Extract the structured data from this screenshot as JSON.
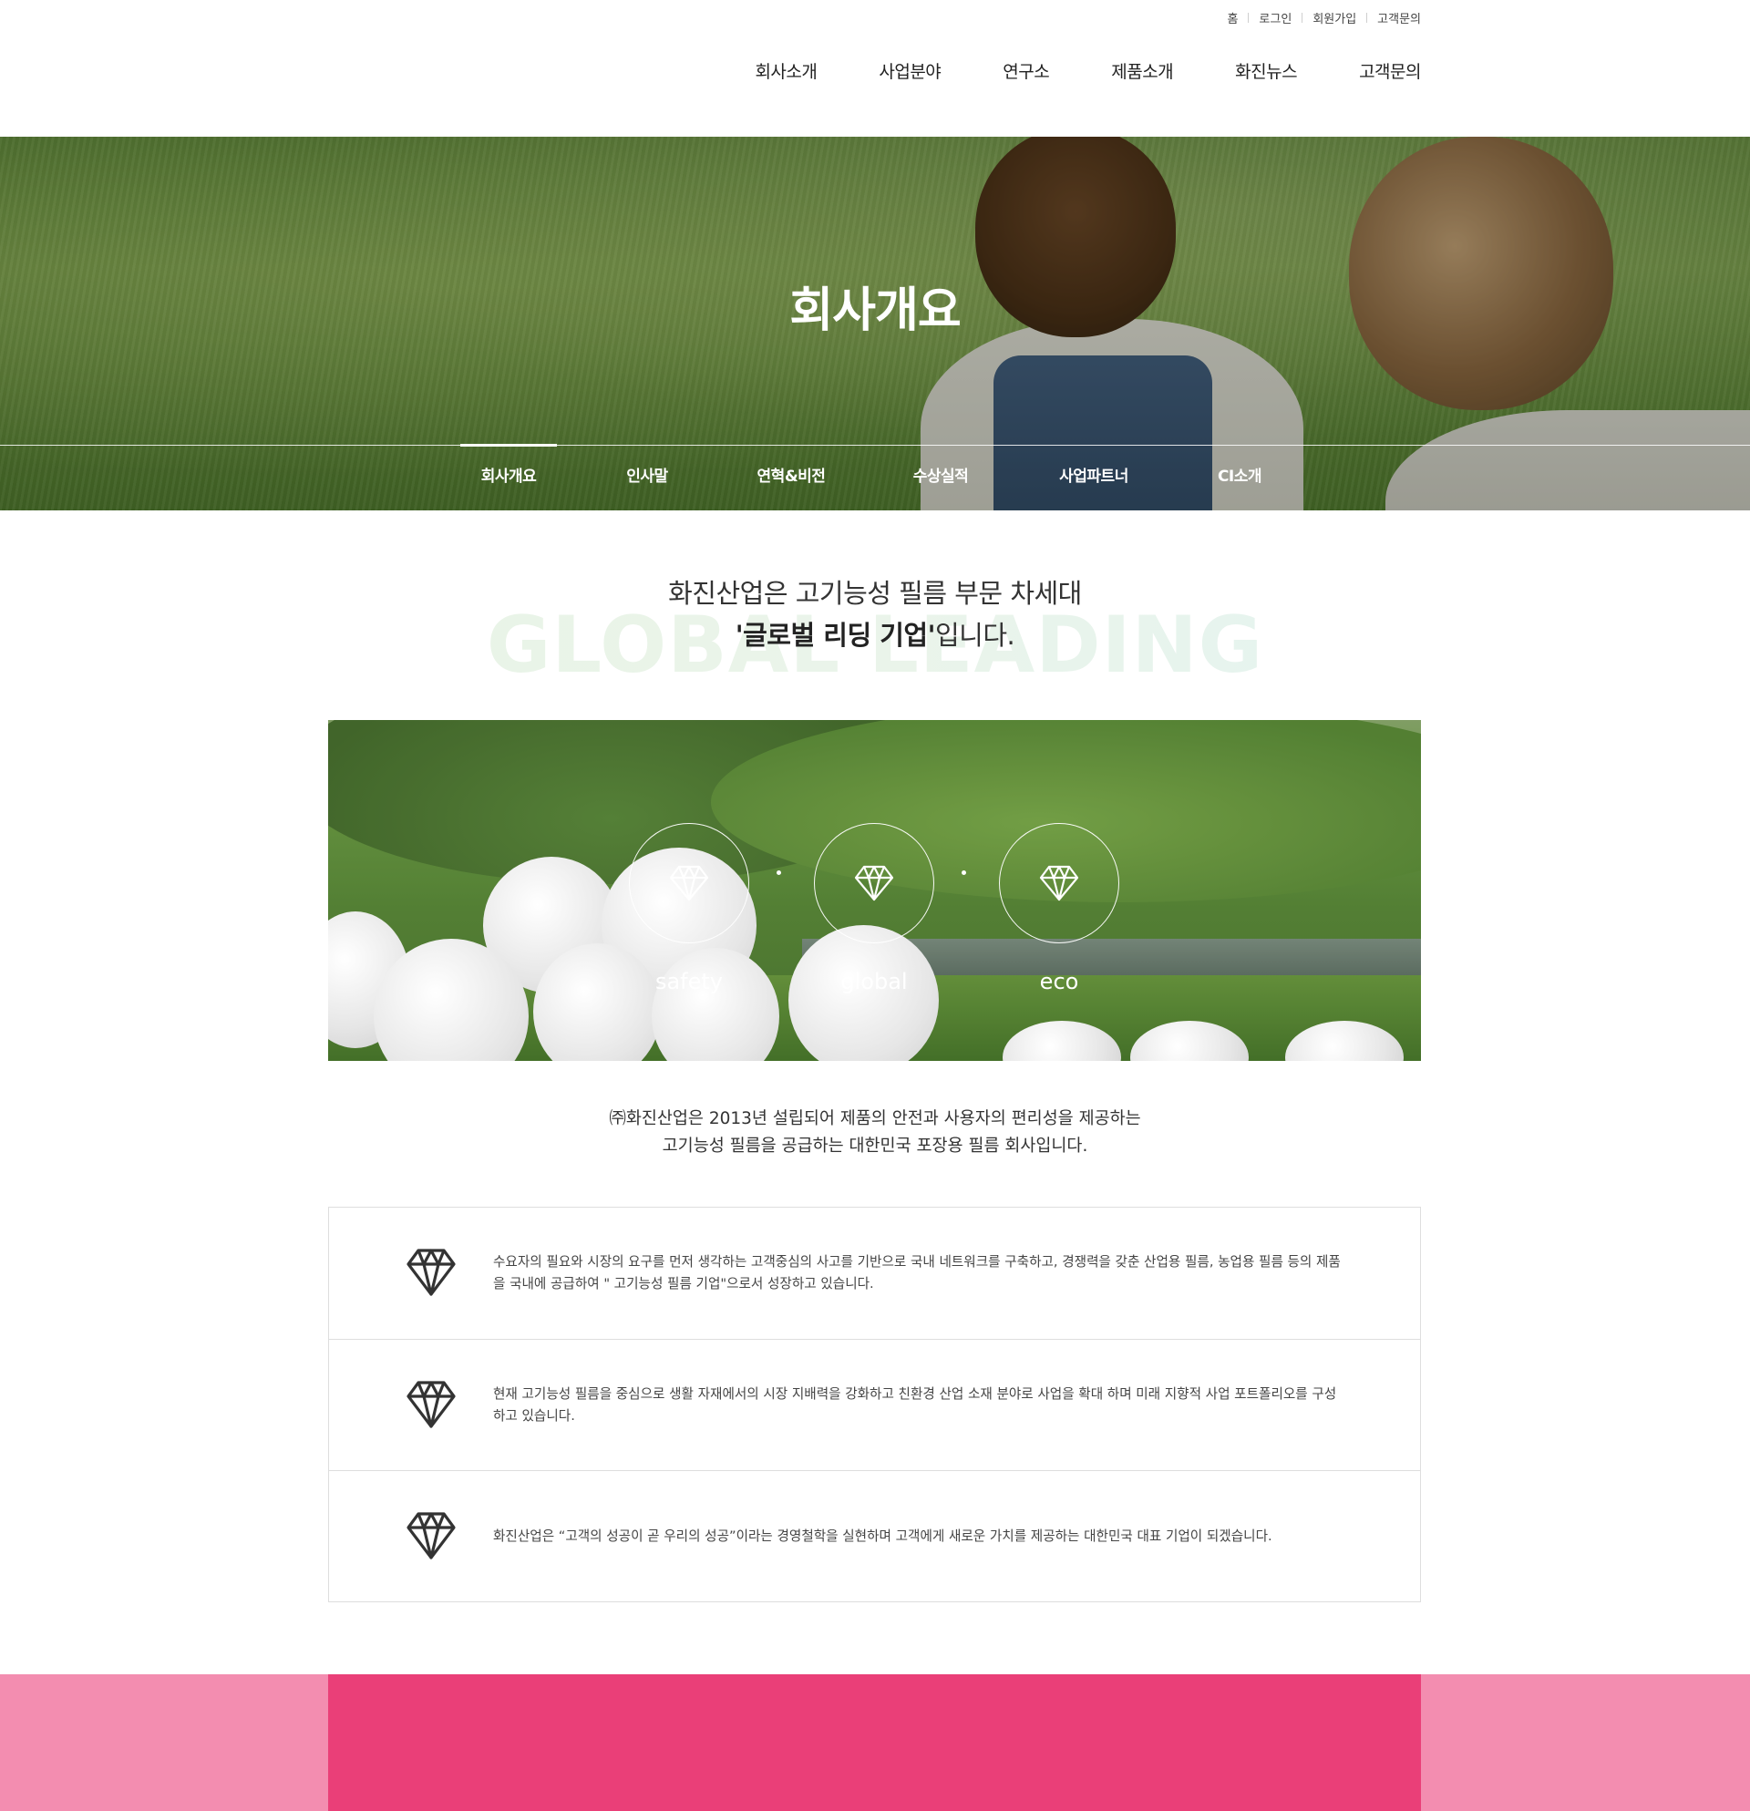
{
  "utility_nav": [
    "홈",
    "로그인",
    "회원가입",
    "고객문의"
  ],
  "main_nav": [
    "회사소개",
    "사업분야",
    "연구소",
    "제품소개",
    "화진뉴스",
    "고객문의"
  ],
  "visual": {
    "title": "회사개요",
    "sub_nav": [
      "회사개요",
      "인사말",
      "연혁&비전",
      "수상실적",
      "사업파트너",
      "CI소개"
    ],
    "active_sub_nav": "회사개요"
  },
  "headline": {
    "line1": "화진산업은 고기능성 필름 부문 차세대",
    "line2_bold": "'글로벌 리딩 기업'",
    "line2_rest": "입니다.",
    "background_word": "GLOBAL LEADING"
  },
  "values": [
    {
      "label": "safety",
      "icon": "diamond-icon"
    },
    {
      "label": "global",
      "icon": "diamond-icon"
    },
    {
      "label": "eco",
      "icon": "diamond-icon"
    }
  ],
  "description": {
    "line1": "㈜화진산업은 2013년 설립되어 제품의 안전과 사용자의 편리성을 제공하는",
    "line2": "고기능성 필름을 공급하는 대한민국 포장용 필름 회사입니다."
  },
  "boxes": [
    {
      "icon": "diamond-icon",
      "text": "수요자의 필요와 시장의 요구를 먼저 생각하는 고객중심의 사고를 기반으로 국내 네트워크를 구축하고, 경쟁력을 갖춘 산업용 필름, 농업용 필름 등의 제품을 국내에 공급하여 \" 고기능성 필름 기업\"으로서 성장하고 있습니다."
    },
    {
      "icon": "diamond-icon",
      "text": "현재 고기능성 필름을 중심으로 생활 자재에서의 시장 지배력을 강화하고 친환경 산업 소재 분야로 사업을 확대 하며 미래 지향적 사업 포트폴리오를 구성하고 있습니다."
    },
    {
      "icon": "diamond-icon",
      "text": "화진산업은 “고객의 성공이 곧 우리의 성공”이라는 경영철학을 실현하며 고객에게 새로운 가치를 제공하는 대한민국 대표 기업이 되겠습니다."
    }
  ],
  "colors": {
    "footer_band_main": "#ea3f78",
    "footer_band_side": "#f38db0",
    "text_dark": "#333333"
  }
}
